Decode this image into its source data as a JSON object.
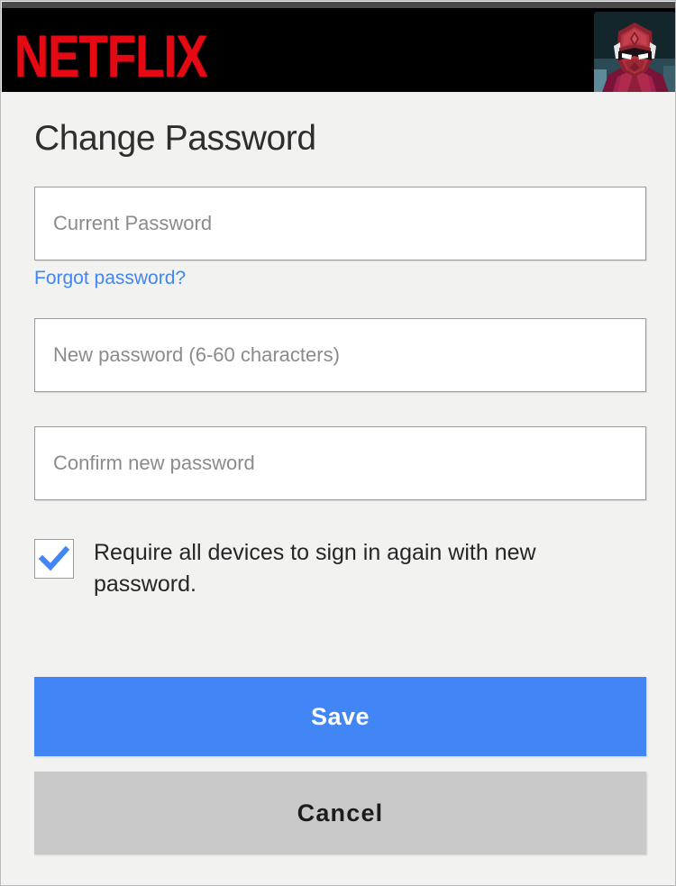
{
  "header": {
    "brand": "NETFLIX",
    "brand_color": "#e50914",
    "background_color": "#000000",
    "avatar_alt": "profile-avatar"
  },
  "page": {
    "title": "Change Password",
    "background_color": "#f2f2f1"
  },
  "form": {
    "current_password": {
      "placeholder": "Current Password",
      "value": ""
    },
    "forgot_link": "Forgot password?",
    "forgot_link_color": "#4285f4",
    "new_password": {
      "placeholder": "New password (6-60 characters)",
      "value": ""
    },
    "confirm_password": {
      "placeholder": "Confirm new password",
      "value": ""
    },
    "require_signin": {
      "label": "Require all devices to sign in again with new password.",
      "checked": "true",
      "check_color": "#4285f4"
    }
  },
  "actions": {
    "save_label": "Save",
    "save_color": "#4285f4",
    "cancel_label": "Cancel",
    "cancel_color": "#c9c9c9"
  }
}
